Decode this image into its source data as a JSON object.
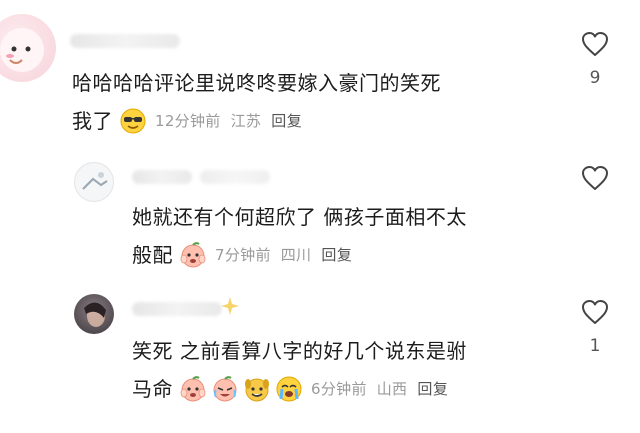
{
  "comments": [
    {
      "text_line1": "哈哈哈哈评论里说咚咚要嫁入豪门的笑死",
      "text_line2": "我了",
      "emojis": [
        "sunglasses-smile-icon"
      ],
      "time": "12分钟前",
      "location": "江苏",
      "reply_label": "回复",
      "like_count": "9"
    },
    {
      "text_line1": "她就还有个何超欣了 俩孩子面相不太",
      "text_line2": "般配",
      "emojis": [
        "peach-hands-on-cheeks-icon"
      ],
      "time": "7分钟前",
      "location": "四川",
      "reply_label": "回复",
      "like_count": ""
    },
    {
      "text_line1": "笑死 之前看算八字的好几个说东是驸",
      "text_line2": "马命",
      "emojis": [
        "peach-hands-on-cheeks-icon",
        "peach-cry-laugh-icon",
        "dog-grin-icon",
        "cry-face-icon"
      ],
      "time": "6分钟前",
      "location": "山西",
      "reply_label": "回复",
      "like_count": "1"
    }
  ],
  "colors": {
    "body_text": "#1c1c1c",
    "meta_text": "#9a9a9a",
    "icon_stroke": "#444444"
  }
}
